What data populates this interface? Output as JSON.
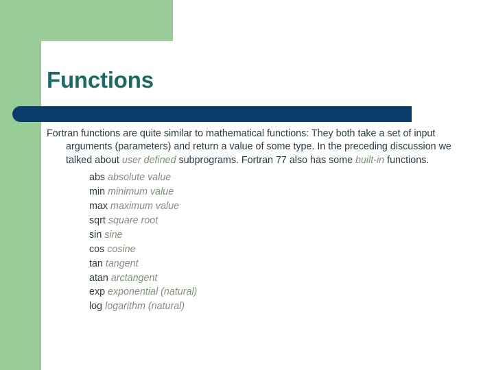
{
  "slide": {
    "title": "Functions",
    "colors": {
      "green_panel": "#97cc97",
      "navy_bar": "#0b3b6b",
      "title_teal": "#1a6b66",
      "body_text": "#2a3b45",
      "italic_text": "#7d9079",
      "background": "#ffffff"
    },
    "body": {
      "paragraph": {
        "part1": "Fortran functions are quite similar to mathematical functions: They both take a set of input arguments (parameters) and return a value of some type. In the preceding discussion we talked about ",
        "emphasis1": "user defined",
        "part2": " subprograms. Fortran 77 also has some ",
        "emphasis2": "built-in",
        "part3": " functions."
      },
      "functions": [
        {
          "name": "abs",
          "description": "absolute value"
        },
        {
          "name": "min",
          "description": "minimum value"
        },
        {
          "name": "max",
          "description": "maximum value"
        },
        {
          "name": "sqrt",
          "description": "square root"
        },
        {
          "name": "sin",
          "description": "sine"
        },
        {
          "name": "cos",
          "description": "cosine"
        },
        {
          "name": "tan",
          "description": "tangent"
        },
        {
          "name": "atan",
          "description": "arctangent"
        },
        {
          "name": "exp",
          "description": "exponential (natural)"
        },
        {
          "name": "log",
          "description": "logarithm (natural)"
        }
      ]
    }
  }
}
